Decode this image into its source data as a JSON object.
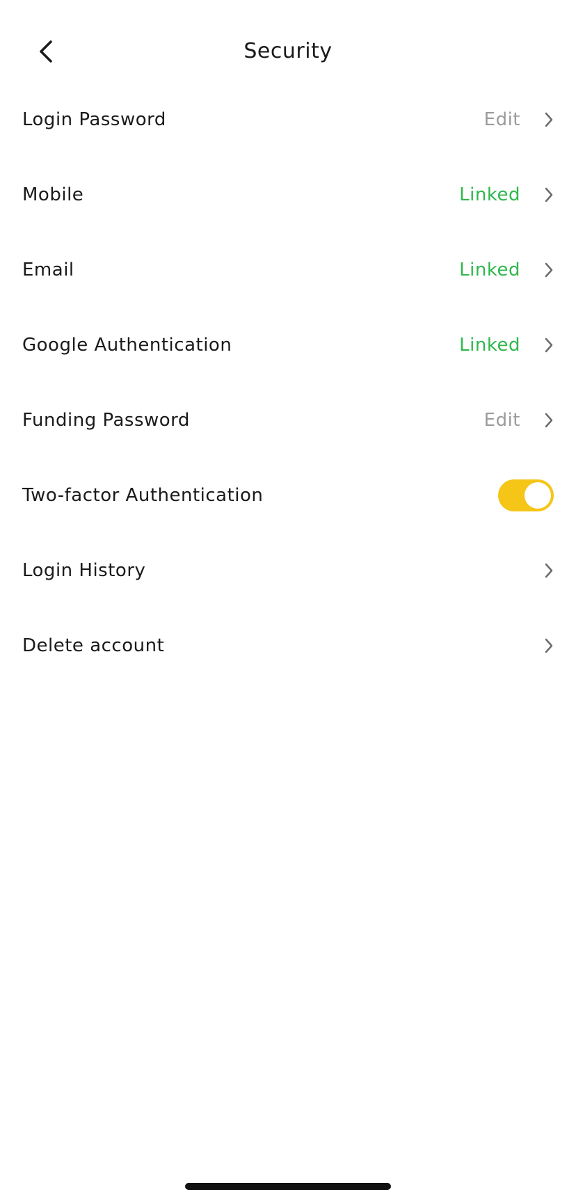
{
  "header": {
    "title": "Security",
    "back_icon": "chevron-left-icon"
  },
  "colors": {
    "status_edit": "#9b9b9b",
    "status_linked": "#2db84c",
    "toggle_on": "#f5c518"
  },
  "rows": [
    {
      "label": "Login Password",
      "status": "Edit"
    },
    {
      "label": "Mobile",
      "status": "Linked"
    },
    {
      "label": "Email",
      "status": "Linked"
    },
    {
      "label": "Google Authentication",
      "status": "Linked"
    },
    {
      "label": "Funding Password",
      "status": "Edit"
    },
    {
      "label": "Two-factor Authentication",
      "toggle_on": true
    },
    {
      "label": "Login History"
    },
    {
      "label": "Delete account"
    }
  ]
}
